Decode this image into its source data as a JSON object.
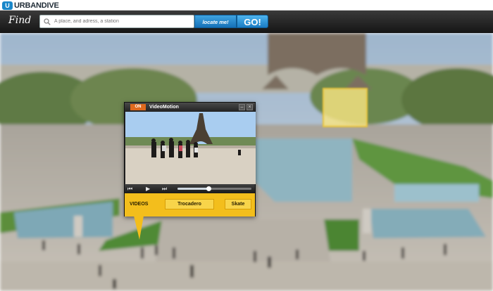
{
  "app": {
    "logo_mark": "U",
    "logo_text": "URBANDIVE"
  },
  "findbar": {
    "label": "Find",
    "search_placeholder": "A place, and adress, a station",
    "locate_label": "locate me!",
    "go_label": "GO!",
    "icons": {
      "search": "search-icon"
    }
  },
  "popup": {
    "on_badge": "ON",
    "title": "VideoMotion",
    "header_buttons": [
      "minimize-icon",
      "close-icon"
    ],
    "controls": {
      "rewind": "⏮",
      "play": "▶",
      "forward": "⏭",
      "progress": 0.42
    },
    "tags_label": "VIDEOS",
    "tags": [
      "Trocadero",
      "Skate"
    ]
  },
  "colors": {
    "accent_blue": "#1a87c9",
    "tag_yellow": "#f3be1c",
    "on_orange": "#e06a1e"
  }
}
